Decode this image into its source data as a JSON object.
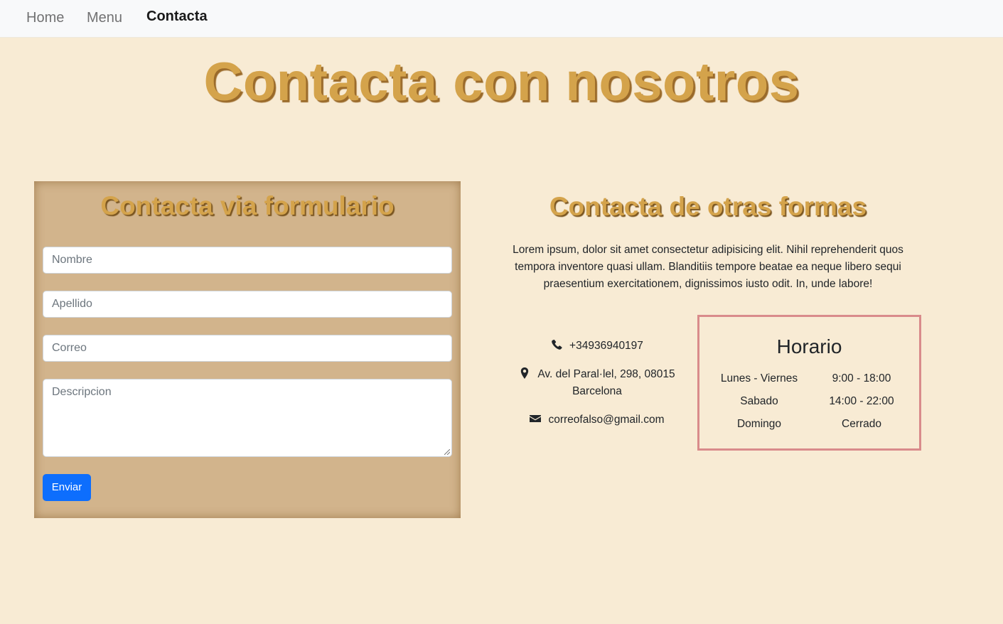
{
  "nav": {
    "items": [
      "Home",
      "Menu",
      "Contacta"
    ],
    "active": "Contacta"
  },
  "page_title": "Contacta con nosotros",
  "form": {
    "title": "Contacta via formulario",
    "nombre_placeholder": "Nombre",
    "apellido_placeholder": "Apellido",
    "correo_placeholder": "Correo",
    "descripcion_placeholder": "Descripcion",
    "submit_label": "Enviar"
  },
  "other": {
    "title": "Contacta de otras formas",
    "description": "Lorem ipsum, dolor sit amet consectetur adipisicing elit. Nihil reprehenderit quos tempora inventore quasi ullam. Blanditiis tempore beatae ea neque libero sequi praesentium exercitationem, dignissimos iusto odit. In, unde labore!",
    "phone": "+34936940197",
    "address_line1": "Av. del Paral·lel, 298, 08015",
    "address_line2": "Barcelona",
    "email": "correofalso@gmail.com"
  },
  "horario": {
    "title": "Horario",
    "rows": [
      {
        "day": "Lunes - Viernes",
        "time": "9:00 - 18:00"
      },
      {
        "day": "Sabado",
        "time": "14:00 - 22:00"
      },
      {
        "day": "Domingo",
        "time": "Cerrado"
      }
    ]
  },
  "colors": {
    "background": "#f8ebd4",
    "title_gold": "#d4a34b",
    "form_card": "#d2b48c",
    "button_blue": "#0d6efd",
    "horario_border": "#d98b8b"
  },
  "icons": [
    "phone-icon",
    "map-pin-icon",
    "envelope-icon"
  ]
}
